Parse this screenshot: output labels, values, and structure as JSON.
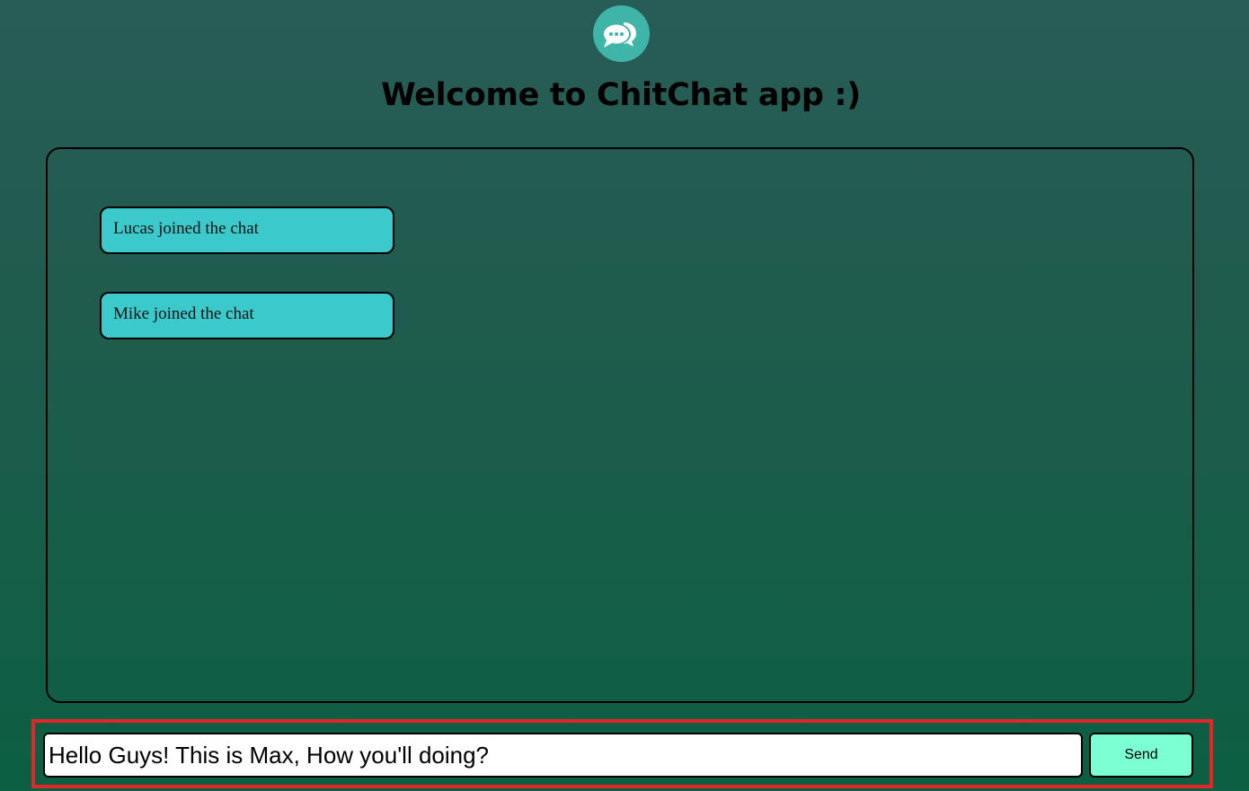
{
  "app": {
    "logo_icon": "chat-bubbles-icon",
    "title": "Welcome to ChitChat app :)"
  },
  "chat": {
    "messages": [
      {
        "text": "Lucas joined the chat"
      },
      {
        "text": "Mike joined the chat"
      }
    ]
  },
  "composer": {
    "input_value": "Hello Guys! This is Max, How you'll doing?",
    "send_label": "Send"
  },
  "colors": {
    "background_top": "#285c57",
    "background_bottom": "#0c5f43",
    "message_bg": "#3bc9cc",
    "send_button_bg": "#7dffd4",
    "logo_bg": "#3fb5a8",
    "highlight_border": "#e42628"
  }
}
